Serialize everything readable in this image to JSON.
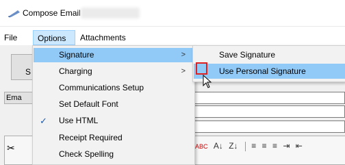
{
  "window": {
    "title": "Compose Email",
    "title_icon": "compose-email-icon"
  },
  "menubar": {
    "items": [
      {
        "label": "File"
      },
      {
        "label": "Options"
      },
      {
        "label": "Attachments"
      }
    ]
  },
  "form": {
    "send_label_partial": "S",
    "email_label_partial": "Ema",
    "toolbar_icons": [
      "cut-icon",
      "spell-check-icon",
      "sort-ascending-icon",
      "sort-descending-icon",
      "align-left-icon",
      "align-center-icon",
      "align-right-icon",
      "indent-icon",
      "outdent-icon"
    ]
  },
  "options_menu": {
    "items": [
      {
        "label": "Signature",
        "submenu": true,
        "highlighted": true
      },
      {
        "label": "Charging",
        "submenu": true
      },
      {
        "label": "Communications Setup"
      },
      {
        "label": "Set Default Font"
      },
      {
        "label": "Use HTML",
        "checked": true
      },
      {
        "label": "Receipt Required"
      },
      {
        "label": "Check Spelling"
      }
    ],
    "arrow_glyph": ">",
    "check_glyph": "✓"
  },
  "signature_submenu": {
    "items": [
      {
        "label": "Save Signature"
      },
      {
        "label": "Use Personal Signature",
        "highlighted": true
      }
    ]
  },
  "colors": {
    "menu_highlight": "#91c9f7",
    "menubar_active": "#cce8ff",
    "annotation_box": "#e01f1f"
  }
}
